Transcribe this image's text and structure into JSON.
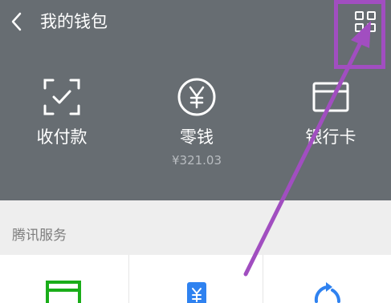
{
  "header": {
    "title": "我的钱包",
    "back_icon": "chevron-left-icon",
    "menu_icon": "grid-icon",
    "background": "#676d72"
  },
  "features": [
    {
      "label": "收付款",
      "icon": "scan-check-icon"
    },
    {
      "label": "零钱",
      "icon": "yuan-circle-icon",
      "balance": "¥321.03"
    },
    {
      "label": "银行卡",
      "icon": "bank-card-icon"
    }
  ],
  "section": {
    "title": "腾讯服务"
  },
  "services": [
    {
      "icon": "credit-card-repay-icon",
      "color": "#1aad19"
    },
    {
      "icon": "mobile-topup-icon",
      "color": "#2f82f0"
    },
    {
      "icon": "wealth-icon",
      "color": "#2f82f0"
    }
  ],
  "annotation": {
    "color": "#a14ec0"
  }
}
